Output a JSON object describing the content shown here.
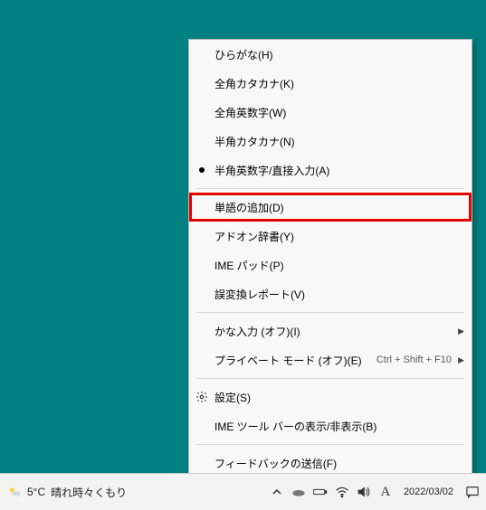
{
  "menu": {
    "items": [
      {
        "label": "ひらがな(H)"
      },
      {
        "label": "全角カタカナ(K)"
      },
      {
        "label": "全角英数字(W)"
      },
      {
        "label": "半角カタカナ(N)"
      },
      {
        "label": "半角英数字/直接入力(A)",
        "selected": true
      }
    ],
    "highlighted": {
      "label": "単語の追加(D)"
    },
    "group2": [
      {
        "label": "アドオン辞書(Y)"
      },
      {
        "label": "IME パッド(P)"
      },
      {
        "label": "誤変換レポート(V)"
      }
    ],
    "group3": [
      {
        "label": "かな入力 (オフ)(I)",
        "submenu": true
      },
      {
        "label": "プライベート モード (オフ)(E)",
        "shortcut": "Ctrl + Shift + F10",
        "submenu": true
      }
    ],
    "group4": [
      {
        "label": "設定(S)",
        "icon": "gear"
      },
      {
        "label": "IME ツール バーの表示/非表示(B)"
      }
    ],
    "group5": [
      {
        "label": "フィードバックの送信(F)"
      }
    ]
  },
  "taskbar": {
    "weather_temp": "5°C",
    "weather_text": "晴れ時々くもり",
    "ime_letter": "A",
    "clock_date": "2022/03/02"
  }
}
